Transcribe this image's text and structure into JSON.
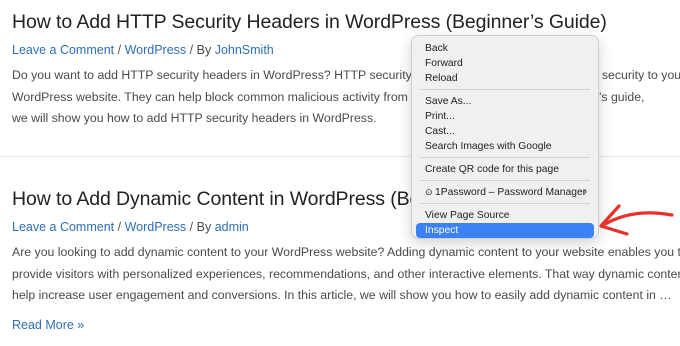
{
  "posts": [
    {
      "title": "How to Add HTTP Security Headers in WordPress (Beginner’s Guide)",
      "meta": {
        "comments": "Leave a Comment",
        "category": "WordPress",
        "by": "By",
        "author": "JohnSmith"
      },
      "excerpt_lines": [
        "Do you want to add HTTP security headers in WordPress? HTTP security headers can add an extra layer of security to your",
        "WordPress website. They can help block common malicious activity from affecting your site. In this beginner’s guide,",
        "we will show you how to add HTTP security headers in WordPress."
      ]
    },
    {
      "title": "How to Add Dynamic Content in WordPress (Beginner’s Guide)",
      "meta": {
        "comments": "Leave a Comment",
        "category": "WordPress",
        "by": "By",
        "author": "admin"
      },
      "excerpt_lines": [
        "Are you looking to add dynamic content to your WordPress website? Adding dynamic content to your website enables you to",
        "provide visitors with personalized experiences, recommendations, and other interactive elements. That way dynamic content can",
        "help increase user engagement and conversions. In this article, we will show you how to easily add dynamic content in …"
      ]
    }
  ],
  "read_more": "Read More »",
  "context_menu": {
    "items": [
      "Back",
      "Forward",
      "Reload",
      "Save As...",
      "Print...",
      "Cast...",
      "Search Images with Google",
      "Create QR code for this page",
      "1Password – Password Manager",
      "View Page Source",
      "Inspect"
    ],
    "highlighted": "Inspect",
    "highlight_color": "#3b82f6"
  },
  "annotation_arrow_color": "#e8312a",
  "link_color": "#2d6fb6"
}
